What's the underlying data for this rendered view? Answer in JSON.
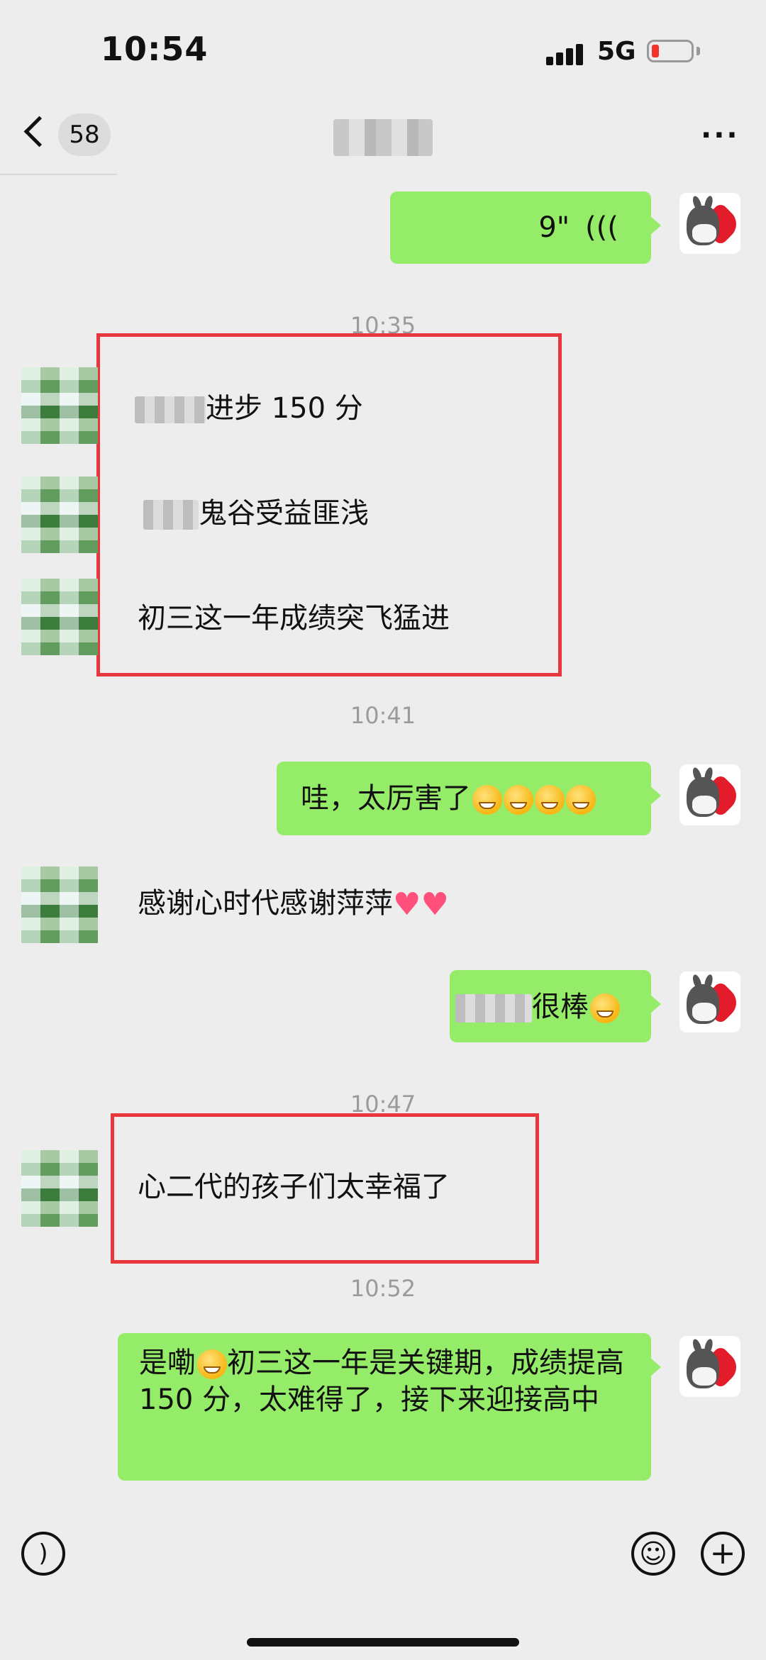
{
  "status": {
    "time": "10:54",
    "network": "5G"
  },
  "nav": {
    "unread_count": "58"
  },
  "messages": {
    "voice_duration": "9\"",
    "ts1": "10:35",
    "m1_text": "进步 150 分",
    "m2_text": "鬼谷受益匪浅",
    "m3_text": "初三这一年成绩突飞猛进",
    "ts2": "10:41",
    "m4_text": "哇，太厉害了",
    "m5_text": "感谢心时代感谢萍萍",
    "m6_text": "很棒",
    "ts3": "10:47",
    "m7_text": "心二代的孩子们太幸福了",
    "ts4": "10:52",
    "m8_pre": "是嘞",
    "m8_text": "初三这一年是关键期，成绩提高 150 分，太难得了，接下来迎接高中"
  },
  "input_bar": {
    "voice_icon": "voice-icon",
    "emoji_icon": "emoji-icon",
    "plus_icon": "plus-icon"
  },
  "colors": {
    "bubble_green": "#95ec69",
    "highlight_red": "#e8383d",
    "background": "#ededed"
  }
}
